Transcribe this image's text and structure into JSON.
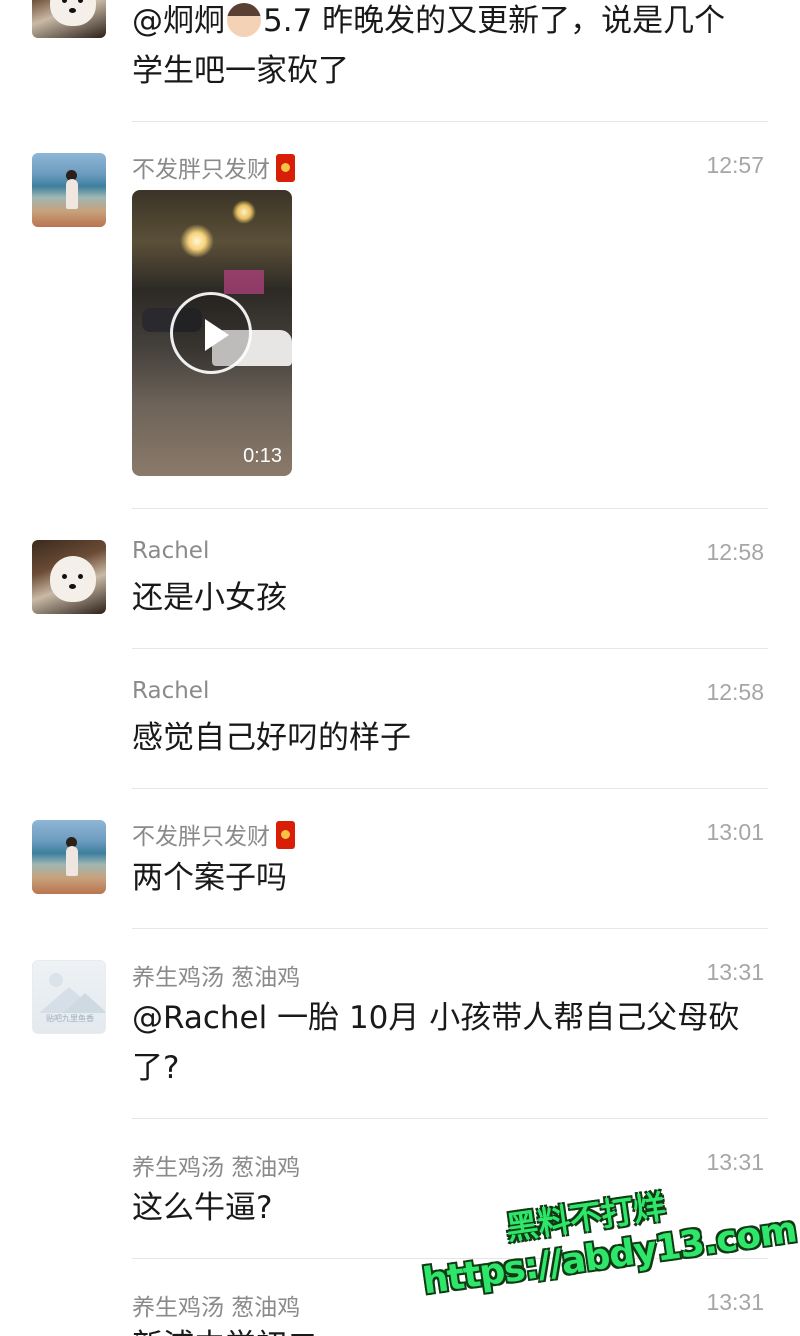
{
  "messages": [
    {
      "avatar": "dog-avatar",
      "name": "",
      "time": "",
      "text_line1": "@炯炯",
      "text_emoji": "man-face-emoji",
      "text_line1_after": "5.7 昨晚发的又更新了，说是几个",
      "text_line2": "学生吧一家砍了"
    },
    {
      "avatar": "beach-avatar",
      "name": "不发胖只发财",
      "badge": "red-packet-icon",
      "time": "12:57",
      "video": {
        "duration": "0:13"
      }
    },
    {
      "avatar": "dog-avatar",
      "name": "Rachel",
      "time": "12:58",
      "text": "还是小女孩"
    },
    {
      "avatar": "",
      "name": "Rachel",
      "time": "12:58",
      "text": "感觉自己好叼的样子"
    },
    {
      "avatar": "beach-avatar",
      "name": "不发胖只发财",
      "badge": "red-packet-icon",
      "time": "13:01",
      "text": "两个案子吗"
    },
    {
      "avatar": "placeholder-avatar",
      "avatar_caption": "贴吧九里鱼香",
      "name": "养生鸡汤 葱油鸡",
      "time": "13:31",
      "text_line1": "@Rachel 一胎 10月 小孩带人帮自己父母砍",
      "text_line2": "了?"
    },
    {
      "avatar": "",
      "name": "养生鸡汤 葱油鸡",
      "time": "13:31",
      "text": "这么牛逼?"
    },
    {
      "avatar": "",
      "name": "养生鸡汤 葱油鸡",
      "time": "13:31",
      "text": "新浦中学初二"
    }
  ],
  "watermark": {
    "line1": "黑料不打烊",
    "line2": "https://abdy13.com"
  },
  "colors": {
    "name": "#8a8a8a",
    "time": "#a6a6a6",
    "text": "#191919",
    "divider": "#e6e6e6",
    "watermark": "#2ee66a"
  }
}
